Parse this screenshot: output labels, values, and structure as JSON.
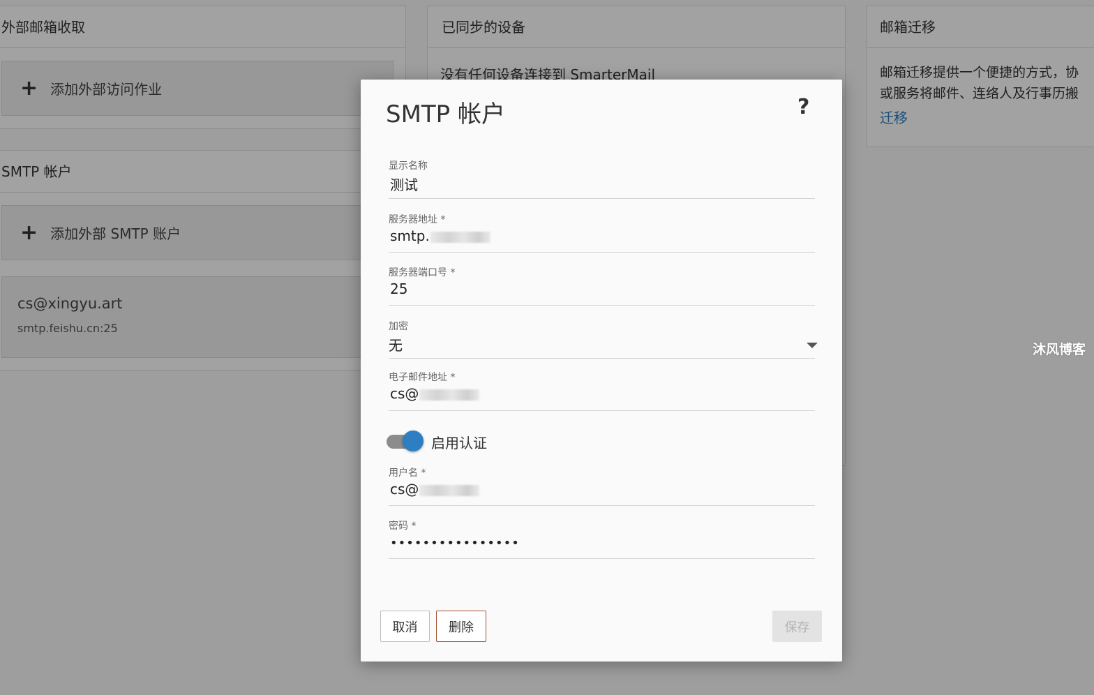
{
  "background": {
    "external_fetch": {
      "title": "外部邮箱收取",
      "add_label": "添加外部访问作业"
    },
    "smtp_accounts": {
      "title": "SMTP 帐户",
      "add_label": "添加外部 SMTP 账户",
      "accounts": [
        {
          "email": "cs@xingyu.art",
          "server": "smtp.feishu.cn:25"
        }
      ]
    },
    "synced_devices": {
      "title": "已同步的设备",
      "message": "没有任何设备连接到 SmarterMail"
    },
    "migration": {
      "title": "邮箱迁移",
      "desc_line1": "邮箱迁移提供一个便捷的方式，协",
      "desc_line2": "或服务将邮件、连络人及行事历搬",
      "link": "迁移"
    }
  },
  "watermark": "沐风博客",
  "modal": {
    "title": "SMTP 帐户",
    "help": "?",
    "fields": {
      "display_name": {
        "label": "显示名称",
        "value": "测试"
      },
      "server": {
        "label": "服务器地址 *",
        "value": "smtp."
      },
      "port": {
        "label": "服务器端口号 *",
        "value": "25"
      },
      "encryption": {
        "label": "加密",
        "value": "无"
      },
      "email": {
        "label": "电子邮件地址 *",
        "value": "cs@"
      },
      "auth_toggle": {
        "label": "启用认证",
        "enabled": true
      },
      "username": {
        "label": "用户名 *",
        "value": "cs@"
      },
      "password": {
        "label": "密码 *",
        "value": "••••••••••••••••"
      }
    },
    "buttons": {
      "cancel": "取消",
      "delete": "删除",
      "save": "保存"
    }
  },
  "colors": {
    "accent": "#2e7fc1",
    "link": "#2b7bbf",
    "delete_border": "#a0522d"
  }
}
